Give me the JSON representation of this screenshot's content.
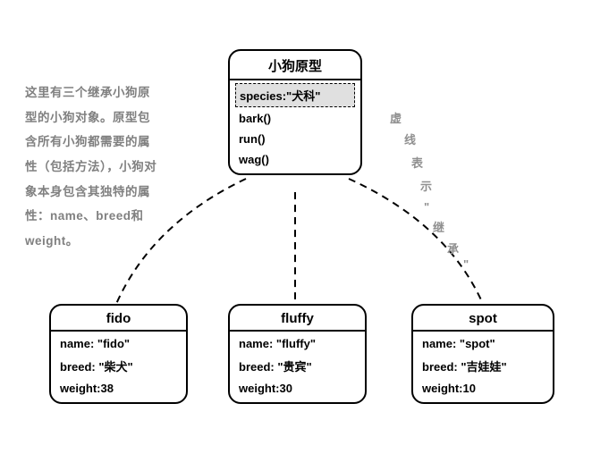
{
  "caption": "这里有三个继承小狗原型的小狗对象。原型包含所有小狗都需要的属性（包括方法），小狗对象本身包含其独特的属性：name、breed和weight。",
  "annotation": {
    "c0": "虚",
    "c1": "线",
    "c2": "表",
    "c3": "示",
    "c4": "\"",
    "c5": "继",
    "c6": "承",
    "c7": "\""
  },
  "prototype": {
    "title": "小狗原型",
    "rows": {
      "r0": "species:\"犬科\"",
      "r1": "bark()",
      "r2": "run()",
      "r3": "wag()"
    }
  },
  "dogs": {
    "fido": {
      "title": "fido",
      "rows": {
        "r0": "name: \"fido\"",
        "r1": "breed: \"柴犬\"",
        "r2": "weight:38"
      }
    },
    "fluffy": {
      "title": "fluffy",
      "rows": {
        "r0": "name: \"fluffy\"",
        "r1": "breed: \"贵宾\"",
        "r2": "weight:30"
      }
    },
    "spot": {
      "title": "spot",
      "rows": {
        "r0": "name: \"spot\"",
        "r1": "breed: \"吉娃娃\"",
        "r2": "weight:10"
      }
    }
  },
  "chart_data": {
    "type": "table",
    "title": "小狗原型继承示意",
    "prototype": {
      "name": "小狗原型",
      "properties": {
        "species": "犬科"
      },
      "methods": [
        "bark()",
        "run()",
        "wag()"
      ]
    },
    "instances": [
      {
        "id": "fido",
        "name": "fido",
        "breed": "柴犬",
        "weight": 38
      },
      {
        "id": "fluffy",
        "name": "fluffy",
        "breed": "贵宾",
        "weight": 30
      },
      {
        "id": "spot",
        "name": "spot",
        "breed": "吉娃娃",
        "weight": 10
      }
    ],
    "edges_note": "虚线表示\"继承\""
  }
}
